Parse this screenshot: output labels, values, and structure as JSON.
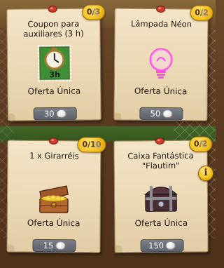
{
  "offers": [
    {
      "title": "Coupon para\nauxiliares (3 h)",
      "counter": "0/3",
      "offer_label": "Oferta Única",
      "price": "30",
      "item_icon": "clock-coupon-icon",
      "badge_text": "3h"
    },
    {
      "title": "Lâmpada Néon",
      "counter": "0/2",
      "offer_label": "Oferta Única",
      "price": "50",
      "item_icon": "neon-lamp-icon"
    },
    {
      "title": "1 x Girarréis",
      "counter": "0/10",
      "offer_label": "Oferta Única",
      "price": "15",
      "item_icon": "treasure-chest-icon"
    },
    {
      "title": "Caixa Fantástica\n\"Flautim\"",
      "counter": "0/2",
      "offer_label": "Oferta Única",
      "price": "150",
      "item_icon": "fantasy-box-icon"
    }
  ],
  "currency_icon": "pearl-icon",
  "info_button": {
    "label": "i",
    "icon": "info-icon"
  },
  "colors": {
    "badge": "#f5c21d",
    "card": "#ead7b3",
    "price_bg": "#6b6f77"
  }
}
